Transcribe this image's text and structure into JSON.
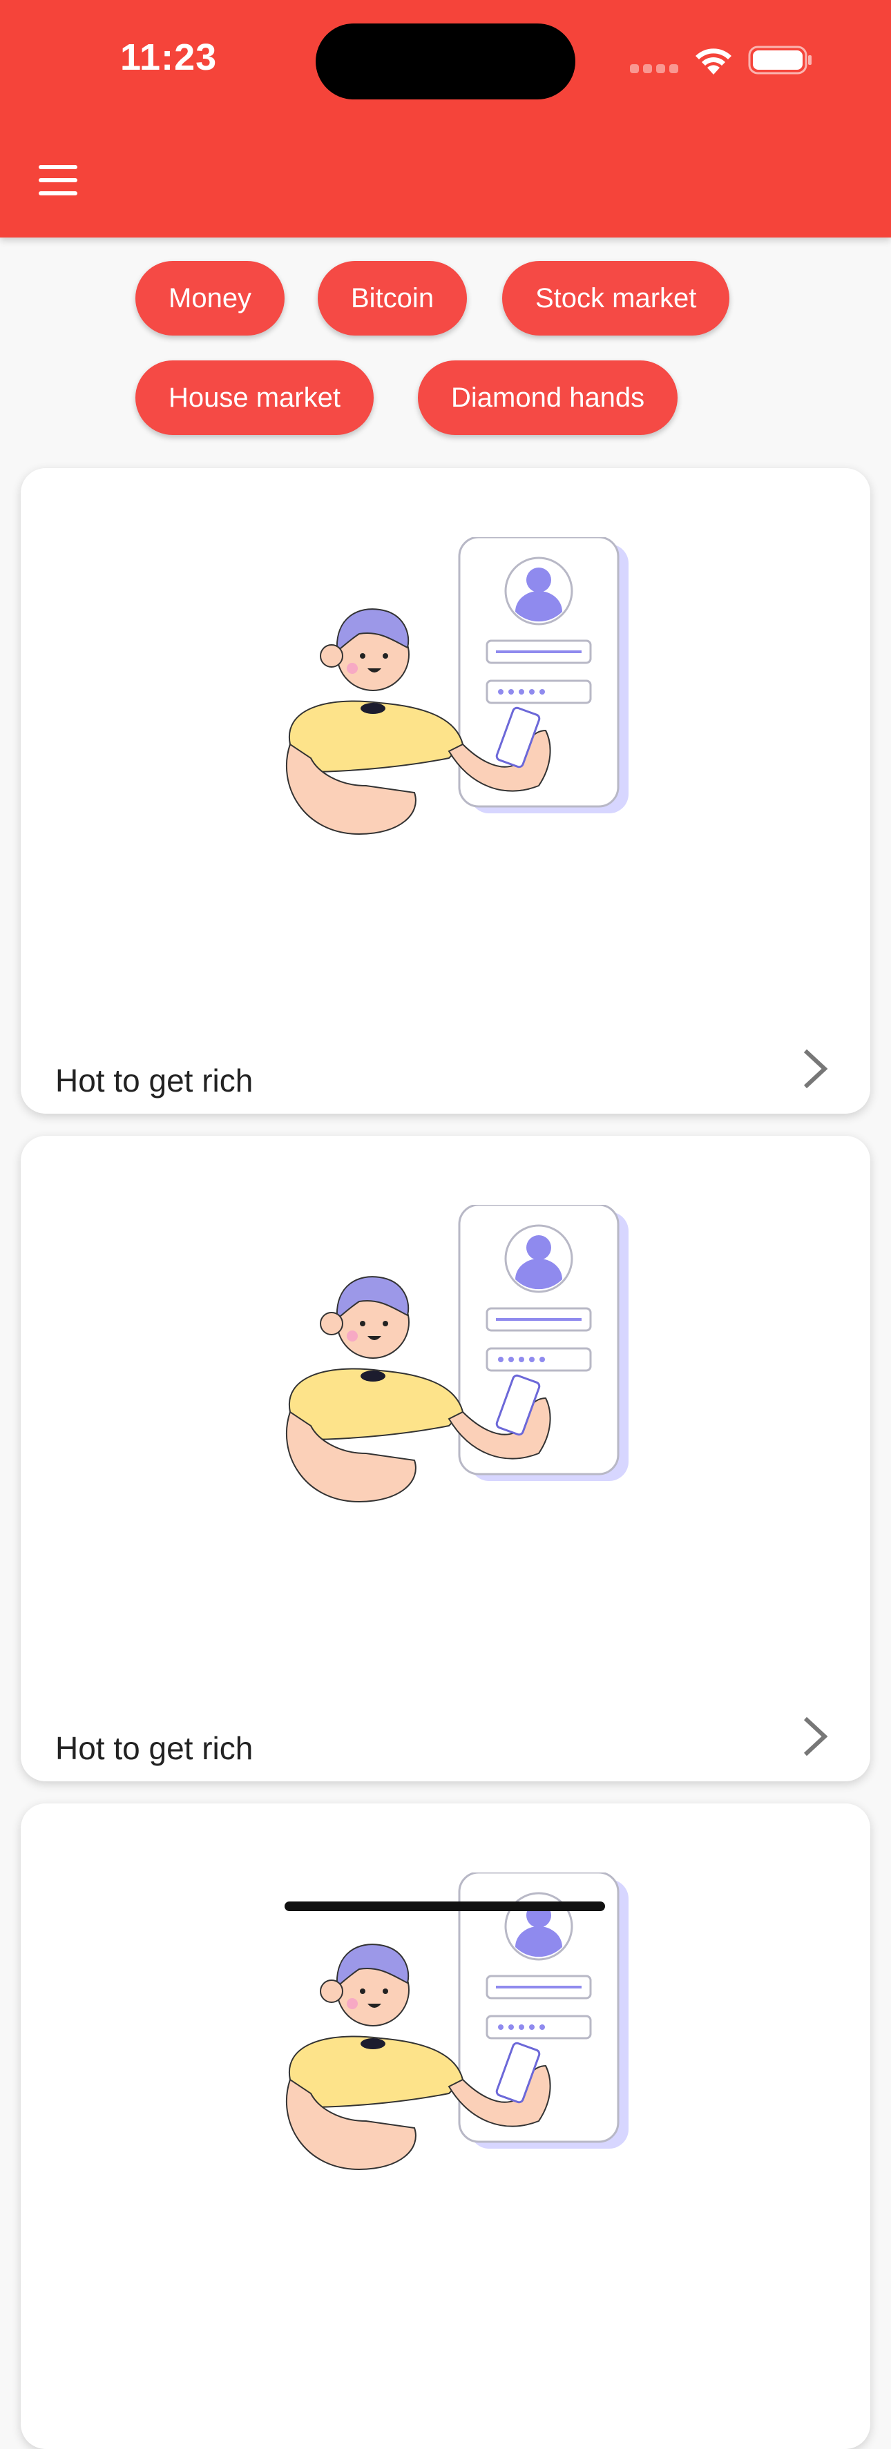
{
  "status_bar": {
    "time": "11:23"
  },
  "app_bar": {
    "menu_icon": "hamburger-menu-icon",
    "background_color": "#f5443a"
  },
  "chips": [
    {
      "label": "Money"
    },
    {
      "label": "Bitcoin"
    },
    {
      "label": "Stock market"
    },
    {
      "label": "House market"
    },
    {
      "label": "Diamond hands"
    }
  ],
  "chip_color": "#f54a45",
  "cards": [
    {
      "title": "Hot to get rich",
      "icon": "chevron-right-icon"
    },
    {
      "title": "Hot to get rich",
      "icon": "chevron-right-icon"
    },
    {
      "title": "",
      "icon": "chevron-right-icon"
    }
  ]
}
